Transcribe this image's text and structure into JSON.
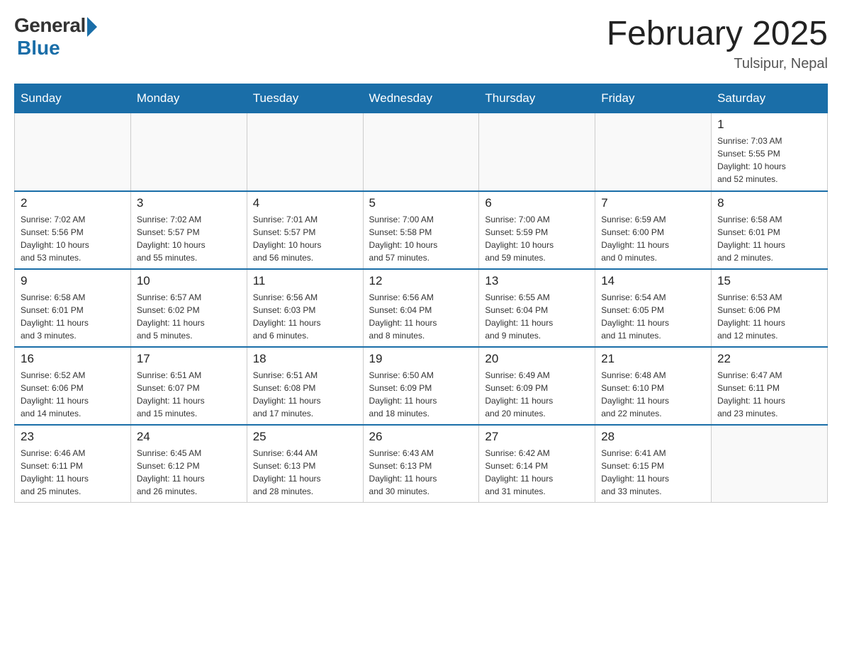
{
  "logo": {
    "general": "General",
    "blue": "Blue"
  },
  "title": "February 2025",
  "subtitle": "Tulsipur, Nepal",
  "days": [
    "Sunday",
    "Monday",
    "Tuesday",
    "Wednesday",
    "Thursday",
    "Friday",
    "Saturday"
  ],
  "weeks": [
    [
      {
        "day": "",
        "info": ""
      },
      {
        "day": "",
        "info": ""
      },
      {
        "day": "",
        "info": ""
      },
      {
        "day": "",
        "info": ""
      },
      {
        "day": "",
        "info": ""
      },
      {
        "day": "",
        "info": ""
      },
      {
        "day": "1",
        "info": "Sunrise: 7:03 AM\nSunset: 5:55 PM\nDaylight: 10 hours\nand 52 minutes."
      }
    ],
    [
      {
        "day": "2",
        "info": "Sunrise: 7:02 AM\nSunset: 5:56 PM\nDaylight: 10 hours\nand 53 minutes."
      },
      {
        "day": "3",
        "info": "Sunrise: 7:02 AM\nSunset: 5:57 PM\nDaylight: 10 hours\nand 55 minutes."
      },
      {
        "day": "4",
        "info": "Sunrise: 7:01 AM\nSunset: 5:57 PM\nDaylight: 10 hours\nand 56 minutes."
      },
      {
        "day": "5",
        "info": "Sunrise: 7:00 AM\nSunset: 5:58 PM\nDaylight: 10 hours\nand 57 minutes."
      },
      {
        "day": "6",
        "info": "Sunrise: 7:00 AM\nSunset: 5:59 PM\nDaylight: 10 hours\nand 59 minutes."
      },
      {
        "day": "7",
        "info": "Sunrise: 6:59 AM\nSunset: 6:00 PM\nDaylight: 11 hours\nand 0 minutes."
      },
      {
        "day": "8",
        "info": "Sunrise: 6:58 AM\nSunset: 6:01 PM\nDaylight: 11 hours\nand 2 minutes."
      }
    ],
    [
      {
        "day": "9",
        "info": "Sunrise: 6:58 AM\nSunset: 6:01 PM\nDaylight: 11 hours\nand 3 minutes."
      },
      {
        "day": "10",
        "info": "Sunrise: 6:57 AM\nSunset: 6:02 PM\nDaylight: 11 hours\nand 5 minutes."
      },
      {
        "day": "11",
        "info": "Sunrise: 6:56 AM\nSunset: 6:03 PM\nDaylight: 11 hours\nand 6 minutes."
      },
      {
        "day": "12",
        "info": "Sunrise: 6:56 AM\nSunset: 6:04 PM\nDaylight: 11 hours\nand 8 minutes."
      },
      {
        "day": "13",
        "info": "Sunrise: 6:55 AM\nSunset: 6:04 PM\nDaylight: 11 hours\nand 9 minutes."
      },
      {
        "day": "14",
        "info": "Sunrise: 6:54 AM\nSunset: 6:05 PM\nDaylight: 11 hours\nand 11 minutes."
      },
      {
        "day": "15",
        "info": "Sunrise: 6:53 AM\nSunset: 6:06 PM\nDaylight: 11 hours\nand 12 minutes."
      }
    ],
    [
      {
        "day": "16",
        "info": "Sunrise: 6:52 AM\nSunset: 6:06 PM\nDaylight: 11 hours\nand 14 minutes."
      },
      {
        "day": "17",
        "info": "Sunrise: 6:51 AM\nSunset: 6:07 PM\nDaylight: 11 hours\nand 15 minutes."
      },
      {
        "day": "18",
        "info": "Sunrise: 6:51 AM\nSunset: 6:08 PM\nDaylight: 11 hours\nand 17 minutes."
      },
      {
        "day": "19",
        "info": "Sunrise: 6:50 AM\nSunset: 6:09 PM\nDaylight: 11 hours\nand 18 minutes."
      },
      {
        "day": "20",
        "info": "Sunrise: 6:49 AM\nSunset: 6:09 PM\nDaylight: 11 hours\nand 20 minutes."
      },
      {
        "day": "21",
        "info": "Sunrise: 6:48 AM\nSunset: 6:10 PM\nDaylight: 11 hours\nand 22 minutes."
      },
      {
        "day": "22",
        "info": "Sunrise: 6:47 AM\nSunset: 6:11 PM\nDaylight: 11 hours\nand 23 minutes."
      }
    ],
    [
      {
        "day": "23",
        "info": "Sunrise: 6:46 AM\nSunset: 6:11 PM\nDaylight: 11 hours\nand 25 minutes."
      },
      {
        "day": "24",
        "info": "Sunrise: 6:45 AM\nSunset: 6:12 PM\nDaylight: 11 hours\nand 26 minutes."
      },
      {
        "day": "25",
        "info": "Sunrise: 6:44 AM\nSunset: 6:13 PM\nDaylight: 11 hours\nand 28 minutes."
      },
      {
        "day": "26",
        "info": "Sunrise: 6:43 AM\nSunset: 6:13 PM\nDaylight: 11 hours\nand 30 minutes."
      },
      {
        "day": "27",
        "info": "Sunrise: 6:42 AM\nSunset: 6:14 PM\nDaylight: 11 hours\nand 31 minutes."
      },
      {
        "day": "28",
        "info": "Sunrise: 6:41 AM\nSunset: 6:15 PM\nDaylight: 11 hours\nand 33 minutes."
      },
      {
        "day": "",
        "info": ""
      }
    ]
  ]
}
